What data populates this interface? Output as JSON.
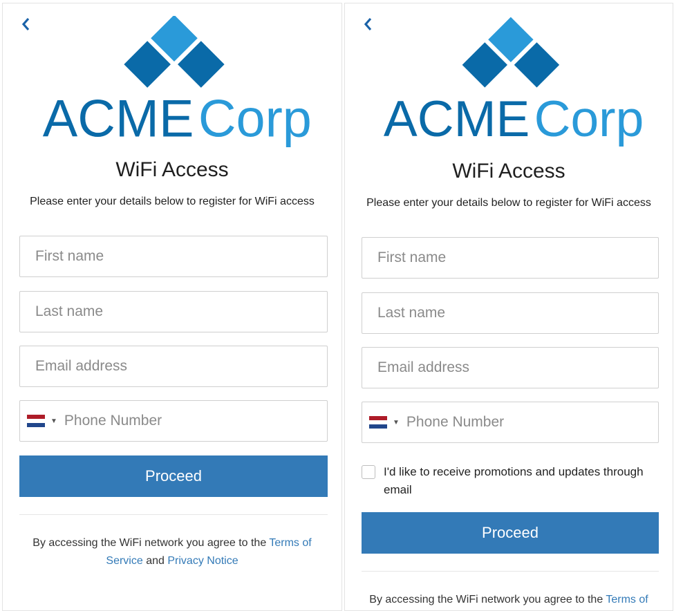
{
  "colors": {
    "primary": "#337ab7",
    "logo_dark": "#0a6aa8",
    "logo_light": "#2a9ad9"
  },
  "icons": {
    "back": "chevron-left-icon",
    "flag": "netherlands-flag-icon",
    "caret": "caret-down-icon"
  },
  "logo": {
    "word1": "ACME",
    "word2": "Corp"
  },
  "form": {
    "title": "WiFi Access",
    "subtitle": "Please enter your details below to register for WiFi access",
    "first_name_placeholder": "First name",
    "last_name_placeholder": "Last name",
    "email_placeholder": "Email address",
    "phone_placeholder": "Phone Number",
    "checkbox_label": "I'd like to receive promotions and updates through email",
    "proceed_label": "Proceed"
  },
  "legal": {
    "prefix": "By accessing the WiFi network you agree to the",
    "terms_link": "Terms of Service",
    "and": "and",
    "privacy_link": "Privacy Notice"
  }
}
